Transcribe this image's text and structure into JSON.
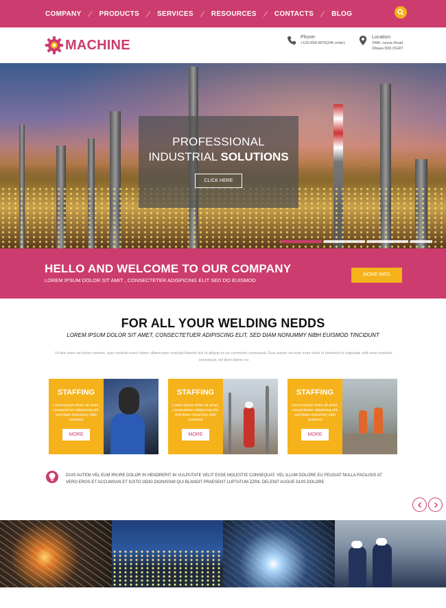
{
  "nav": {
    "items": [
      "COMPANY",
      "PRODUCTS",
      "SERVICES",
      "RESOURCES",
      "CONTACTS",
      "BLOG"
    ]
  },
  "brand": {
    "name": "MACHINE",
    "primary_color": "#cc3c6e",
    "accent_color": "#f5b21a"
  },
  "header": {
    "phone_label": "Phone:",
    "phone_value": "+120-658-5876(24h order)",
    "location_label": "Location:",
    "location_line1": "2486-.nexus Road",
    "location_line2": "Ollawa D65 OGRT"
  },
  "hero": {
    "line1": "PROFESSIONAL",
    "line2_plain": "INDUSTRIAL",
    "line2_bold": "SOLUTIONS",
    "button": "CLICK HERE"
  },
  "welcome": {
    "title": "HELLO AND WELCOME TO OUR COMPANY",
    "subtitle": "LOREM IPSUM DOLOR SIT AMIT , CONSECTETER ADISPICING ELIT SED DO EUISMOD",
    "button": "MORE INFO"
  },
  "welding": {
    "title": "FOR ALL YOUR WELDING NEDDS",
    "subtitle": "LOREM IPSUM DOLOR SIT AMET, CONSECTETUER ADIPISCING ELIT, SED DIAM NONUMMY NIBH EUISMOD TINCIDUNT",
    "description": "Ut wisi enim ad minim veniam, quis nostrud exerci tation ullamcorper suscipit lobortis nisl ut aliquip ex ea commodo consequat. Duis autem vel eum iriure dolor in hendrerit in vulputate velit esse molestie consequat, vel illum dolore eu"
  },
  "cards": [
    {
      "title": "STAFFING",
      "text": "Lorem ipsum dolor sit amet, consectetuer adipiscing elit, sed diam nonummy nibh euismod",
      "button": "MORE"
    },
    {
      "title": "STAFFING",
      "text": "Lorem ipsum dolor sit amet, consectetuer adipiscing elit, sed diam nonummy nibh euismod",
      "button": "MORE"
    },
    {
      "title": "STAFFING",
      "text": "Lorem ipsum dolor sit amet, consectetuer adipiscing elit, sed diam nonummy nibh euismod",
      "button": "MORE"
    }
  ],
  "info": {
    "text": "DUIS AUTEM VEL EUM IRIURE DOLOR IN HENDRERIT IN VULPUTATE VELIT ESSE MOLESTIE CONSEQUAT, VEL ILLUM DOLORE EU FEUGIAT NULLA FACILISIS AT VERO EROS ET ACCUMSAN ET IUSTO ODIO DIGNISSIM QUI BLANDIT PRAESENT LUPTATUM ZZRIL DELENIT AUGUE DUIS DOLORE"
  },
  "slider": {
    "active_index": 0,
    "count": 4
  }
}
